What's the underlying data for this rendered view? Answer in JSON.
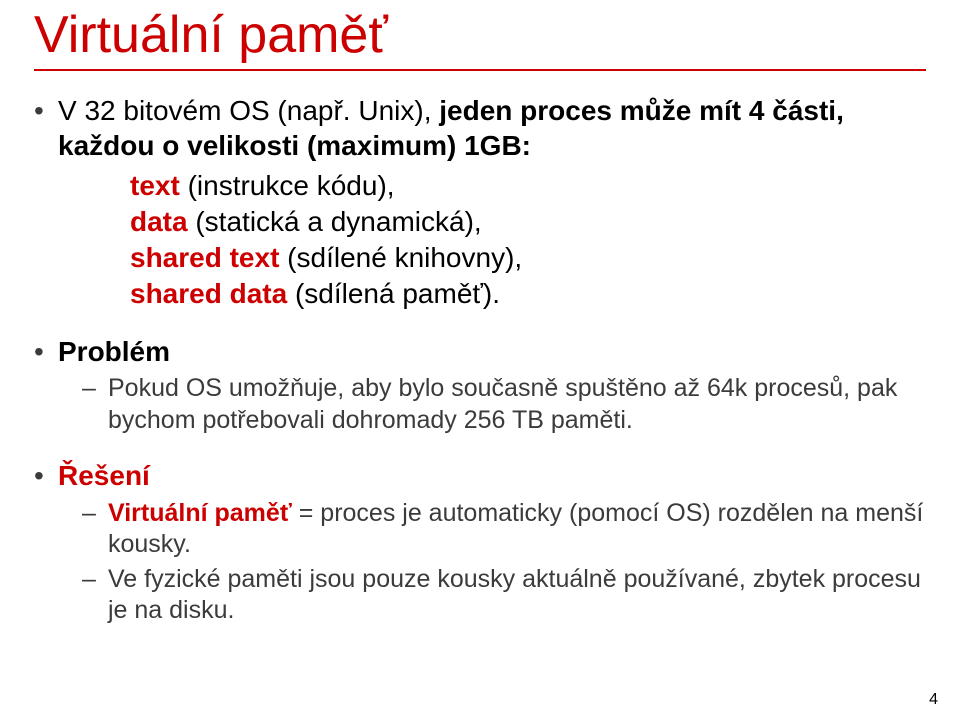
{
  "title": "Virtuální paměť",
  "intro": {
    "lead": "V 32 bitovém OS (např. Unix), ",
    "lead2": "jeden proces může mít 4 části, každou o velikosti (maximum) 1GB:",
    "parts": {
      "text_label": "text ",
      "text_desc": "(instrukce kódu),",
      "data_label": "data ",
      "data_desc": "(statická a dynamická),",
      "shared_text_label": "shared text ",
      "shared_text_desc": "(sdílené knihovny),",
      "shared_data_label": "shared data ",
      "shared_data_desc": "(sdílená paměť)."
    }
  },
  "problem": {
    "heading": "Problém",
    "body": "Pokud OS umožňuje, aby bylo současně spuštěno až 64k procesů, pak bychom potřebovali dohromady 256 TB paměti."
  },
  "solution": {
    "heading": "Řešení",
    "line1_prefix": "Virtuální paměť",
    "line1_rest": " = proces je automaticky (pomocí OS) rozdělen na menší kousky.",
    "line2": "Ve fyzické paměti jsou pouze kousky aktuálně používané, zbytek procesu je na disku."
  },
  "page_number": "4"
}
